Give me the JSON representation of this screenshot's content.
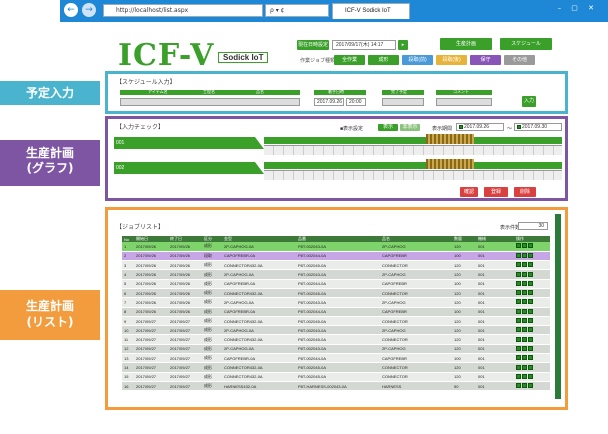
{
  "browser": {
    "address": "http://localhost/list.aspx",
    "address_ctrl": "ρ ▾ ¢",
    "tab_title": "ICF-V Sodick IoT",
    "window_controls": "– ▢ ✕",
    "nav_back": "←",
    "nav_forward": "→"
  },
  "header": {
    "logo": "ICF-V",
    "logo_sub": "Sodick IoT",
    "date_label": "現在日時設定",
    "date_value": "2017/09/17(木) 14:17",
    "btn_top1": "生産計画",
    "btn_top2": "スケジュール",
    "filter_label": "作業ジョブ種類",
    "filters": [
      {
        "label": "全作業",
        "color": "#3aa02a"
      },
      {
        "label": "成形",
        "color": "#3aa02a"
      },
      {
        "label": "段取(前)",
        "color": "#4a9ad8"
      },
      {
        "label": "段取(後)",
        "color": "#e7b43b"
      },
      {
        "label": "保守",
        "color": "#8a55b8"
      },
      {
        "label": "その他",
        "color": "#9a9a9a"
      }
    ]
  },
  "side_labels": {
    "yotei": "予定入力",
    "graph_1": "生産計画",
    "graph_2": "(グラフ)",
    "list_1": "生産計画",
    "list_2": "(リスト)"
  },
  "schedule": {
    "title": "【スケジュール入力】",
    "col_labels": [
      "アイテム名",
      "工程名",
      "品名",
      "着手日時",
      "完了予定",
      "コメント"
    ],
    "start_date": "2017.09.26",
    "start_time": "20:00",
    "add_btn": "入力"
  },
  "check": {
    "title": "【入力チェック】",
    "filter_label": "■表示設定",
    "toggle_on": "表示",
    "toggle_off": "非表示",
    "range_label": "表示期間",
    "range_from": "2017.09.26",
    "range_to": "2017.09.30",
    "rows": [
      "001",
      "002"
    ],
    "btn_check": "確認",
    "btn_save": "登録",
    "btn_clear": "削除"
  },
  "joblist": {
    "title": "【ジョブリスト】",
    "count_label": "表示件数",
    "count_value": "30",
    "columns": [
      "No",
      "開始日",
      "終了日",
      "区分",
      "金型",
      "品番",
      "品名",
      "数量",
      "機械",
      "操作"
    ],
    "rows": [
      [
        "1",
        "2017/09/26",
        "2017/09/26",
        "成形",
        "2P-CAPHOG-0A",
        "P8T-002043-0A",
        "2P-CAPHOG",
        "120",
        "001"
      ],
      [
        "2",
        "2017/09/26",
        "2017/09/26",
        "段取",
        "CAPGFREBR-0A",
        "P8T-002044-0A",
        "CAPGFREBR",
        "100",
        "001"
      ],
      [
        "3",
        "2017/09/26",
        "2017/09/26",
        "成形",
        "CONNECTOR432-0A",
        "P8T-002045-0A",
        "CONNECTOR",
        "120",
        "001"
      ],
      [
        "4",
        "2017/09/26",
        "2017/09/26",
        "成形",
        "2P-CAPHOG-0A",
        "P8T-002043-0A",
        "2P-CAPHOG",
        "120",
        "001"
      ],
      [
        "5",
        "2017/09/26",
        "2017/09/26",
        "成形",
        "CAPGFREBR-0A",
        "P8T-002044-0A",
        "CAPGFREBR",
        "100",
        "001"
      ],
      [
        "6",
        "2017/09/26",
        "2017/09/26",
        "成形",
        "CONNECTOR432-0A",
        "P8T-002045-0A",
        "CONNECTOR",
        "120",
        "001"
      ],
      [
        "7",
        "2017/09/26",
        "2017/09/26",
        "成形",
        "2P-CAPHOG-0A",
        "P8T-002043-0A",
        "2P-CAPHOG",
        "120",
        "001"
      ],
      [
        "8",
        "2017/09/26",
        "2017/09/26",
        "成形",
        "CAPGFREBR-0A",
        "P8T-002044-0A",
        "CAPGFREBR",
        "100",
        "001"
      ],
      [
        "9",
        "2017/09/27",
        "2017/09/27",
        "成形",
        "CONNECTOR432-0A",
        "P8T-002045-0A",
        "CONNECTOR",
        "120",
        "001"
      ],
      [
        "10",
        "2017/09/27",
        "2017/09/27",
        "成形",
        "2P-CAPHOG-0A",
        "P8T-002043-0A",
        "2P-CAPHOG",
        "120",
        "001"
      ],
      [
        "11",
        "2017/09/27",
        "2017/09/27",
        "成形",
        "CONNECTOR432-0A",
        "P8T-002045-0A",
        "CONNECTOR",
        "120",
        "001"
      ],
      [
        "12",
        "2017/09/27",
        "2017/09/27",
        "成形",
        "2P-CAPHOG-0A",
        "P8T-002043-0A",
        "2P-CAPHOG",
        "120",
        "001"
      ],
      [
        "13",
        "2017/09/27",
        "2017/09/27",
        "成形",
        "CAPGFREBR-0A",
        "P8T-002044-0A",
        "CAPGFREBR",
        "100",
        "001"
      ],
      [
        "14",
        "2017/09/27",
        "2017/09/27",
        "成形",
        "CONNECTOR432-0A",
        "P8T-002045-0A",
        "CONNECTOR",
        "120",
        "001"
      ],
      [
        "15",
        "2017/09/27",
        "2017/09/27",
        "成形",
        "CONNECTOR432-0A",
        "P8T-002045-0A",
        "CONNECTOR",
        "120",
        "001"
      ],
      [
        "16",
        "2017/09/27",
        "2017/09/27",
        "成形",
        "HARNESS432-0A",
        "P8T-HARNESS-002043-0A",
        "HARNESS",
        "50",
        "001"
      ]
    ]
  },
  "colors": {
    "accent_green": "#3aa02a",
    "side_blue": "#4ab4cf",
    "side_purple": "#7e55a3",
    "side_orange": "#f29c3e"
  }
}
